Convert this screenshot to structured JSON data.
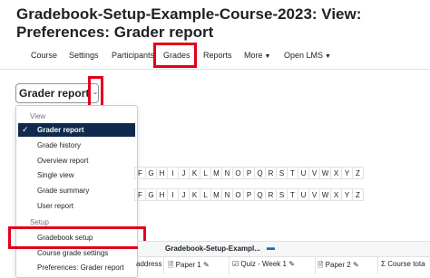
{
  "page": {
    "title": "Gradebook-Setup-Example-Course-2023: View: Preferences: Grader report"
  },
  "nav": {
    "items": [
      {
        "label": "Course"
      },
      {
        "label": "Settings"
      },
      {
        "label": "Participants"
      },
      {
        "label": "Grades"
      },
      {
        "label": "Reports"
      },
      {
        "label": "More"
      },
      {
        "label": "Open LMS"
      }
    ],
    "active": "Grades"
  },
  "selector": {
    "label": "Grader report"
  },
  "dropdown": {
    "groups": [
      {
        "label": "View",
        "items": [
          "Grader report",
          "Grade history",
          "Overview report",
          "Single view",
          "Grade summary",
          "User report"
        ]
      },
      {
        "label": "Setup",
        "items": [
          "Gradebook setup",
          "Course grade settings",
          "Preferences: Grader report"
        ]
      }
    ],
    "selected": "Grader report",
    "highlighted": "Gradebook setup"
  },
  "letters": [
    "F",
    "G",
    "H",
    "I",
    "J",
    "K",
    "L",
    "M",
    "N",
    "O",
    "P",
    "Q",
    "R",
    "S",
    "T",
    "U",
    "V",
    "W",
    "X",
    "Y",
    "Z"
  ],
  "table": {
    "category_header": "Gradebook-Setup-Exampl...",
    "columns": [
      "address",
      "Paper 1",
      "Quiz - Week 1",
      "Paper 2",
      "Course tota"
    ]
  },
  "colors": {
    "accent": "#0f6cbf",
    "highlight_box": "#e2001a",
    "selected_item_bg": "#0f2a4d"
  }
}
